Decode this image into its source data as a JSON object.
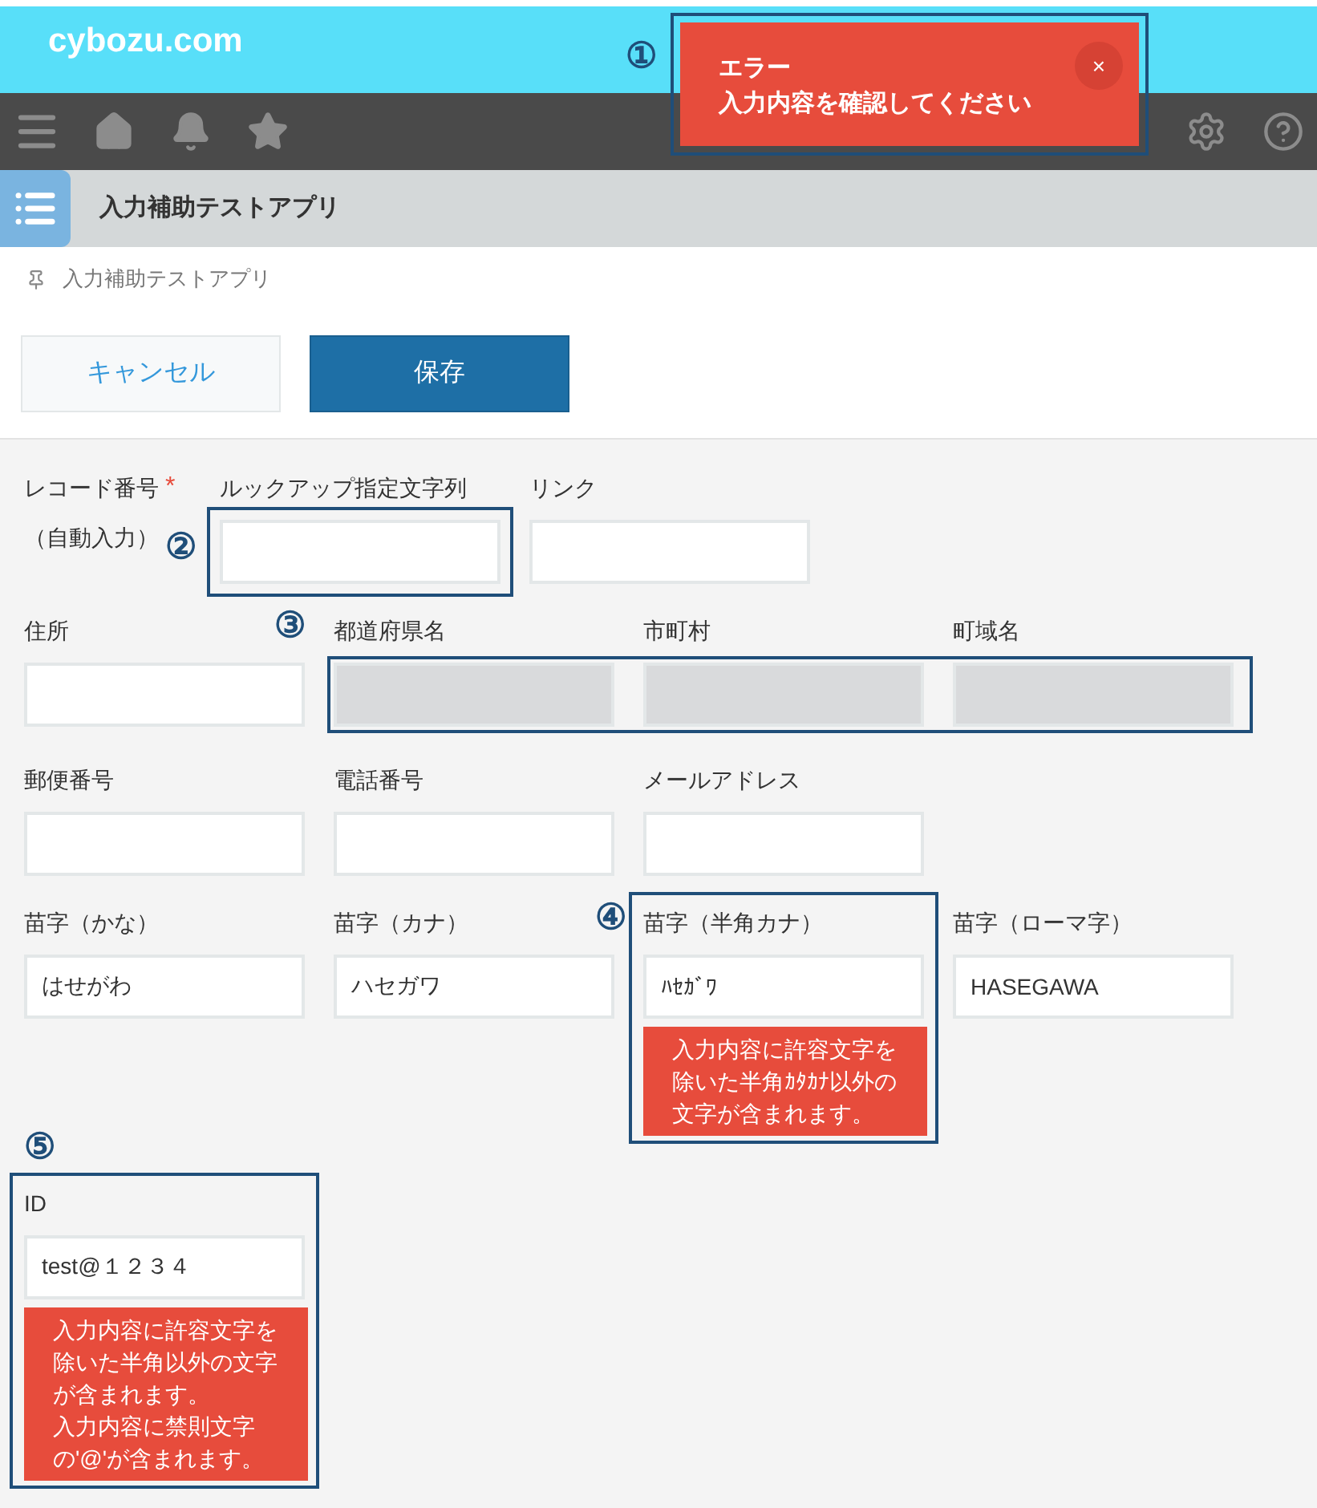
{
  "header": {
    "logo": "cybozu.com"
  },
  "toast": {
    "title": "エラー",
    "message": "入力内容を確認してください",
    "close": "×",
    "annotation": "①"
  },
  "app": {
    "title": "入力補助テストアプリ"
  },
  "breadcrumb": "入力補助テストアプリ",
  "buttons": [
    {
      "label": "キャンセル",
      "kind": "secondary"
    },
    {
      "label": "保存",
      "kind": "primary"
    }
  ],
  "rows": [
    {
      "items": [
        {
          "kind": "record_number",
          "label": "レコード番号",
          "required_mark": "*",
          "note": "（自動入力）"
        },
        {
          "kind": "text",
          "label": "ルックアップ指定文字列",
          "highlight_input": true,
          "annotation": "②"
        },
        {
          "kind": "text",
          "label": "リンク"
        }
      ]
    },
    {
      "items": [
        {
          "kind": "text",
          "label": "住所"
        },
        {
          "kind": "group",
          "annotation": "③",
          "fields": [
            {
              "kind": "disabled",
              "label": "都道府県名"
            },
            {
              "kind": "disabled",
              "label": "市町村"
            },
            {
              "kind": "disabled",
              "label": "町域名"
            }
          ]
        }
      ]
    },
    {
      "items": [
        {
          "kind": "text",
          "label": "郵便番号"
        },
        {
          "kind": "text",
          "label": "電話番号"
        },
        {
          "kind": "text",
          "label": "メールアドレス"
        }
      ]
    },
    {
      "items": [
        {
          "kind": "text",
          "label": "苗字（かな）",
          "value": "はせがわ"
        },
        {
          "kind": "text",
          "label": "苗字（カナ）",
          "value": "ハセガワ"
        },
        {
          "kind": "text",
          "label": "苗字（半角カナ）",
          "value": "ﾊｾｶﾞﾜ",
          "highlight_field": true,
          "annotation": "④",
          "marker_above": false,
          "errors": [
            "入力内容に許容文字を除いた半角ｶﾀｶﾅ以外の文字が含まれます。"
          ]
        },
        {
          "kind": "text",
          "label": "苗字（ローマ字）",
          "value": "HASEGAWA"
        }
      ]
    },
    {
      "items": [
        {
          "kind": "text",
          "label": "ID",
          "value": "test@１２３４",
          "highlight_field": true,
          "annotation": "⑤",
          "marker_above": true,
          "errors": [
            "入力内容に許容文字を除いた半角以外の文字が含まれます。",
            "入力内容に禁則文字の'@'が含まれます。"
          ]
        }
      ]
    }
  ]
}
